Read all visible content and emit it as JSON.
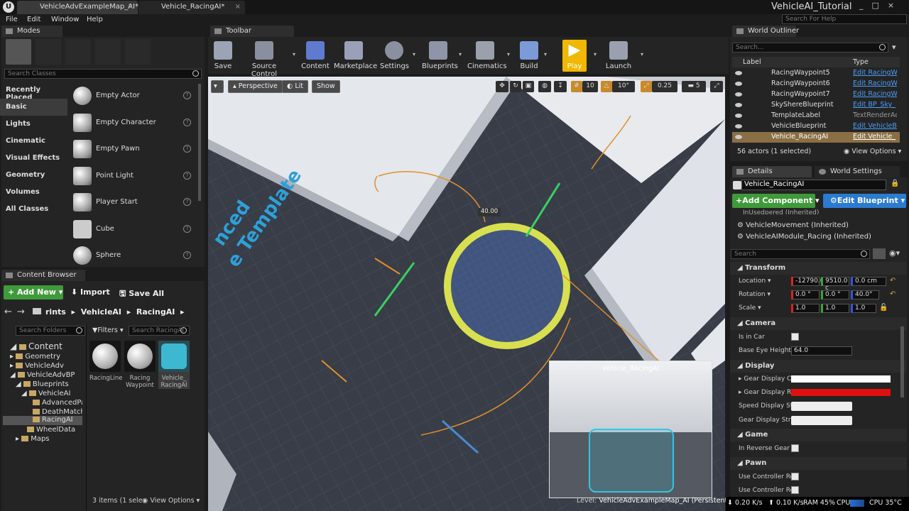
{
  "tabs": [
    "VehicleAdvExampleMap_AI*",
    "Vehicle_RacingAI*"
  ],
  "app_title": "VehicleAI_Tutorial",
  "help_search_placeholder": "Search For Help",
  "menu": [
    "File",
    "Edit",
    "Window",
    "Help"
  ],
  "modes": {
    "title": "Modes",
    "search_placeholder": "Search Classes",
    "categories": [
      "Recently Placed",
      "Basic",
      "Lights",
      "Cinematic",
      "Visual Effects",
      "Geometry",
      "Volumes",
      "All Classes"
    ],
    "classes": [
      "Empty Actor",
      "Empty Character",
      "Empty Pawn",
      "Point Light",
      "Player Start",
      "Cube",
      "Sphere"
    ]
  },
  "toolbar": {
    "title": "Toolbar",
    "buttons": [
      "Save",
      "Source Control",
      "Content",
      "Marketplace",
      "Settings",
      "Blueprints",
      "Cinematics",
      "Build",
      "Play",
      "Launch"
    ]
  },
  "viewport": {
    "perspective": "Perspective",
    "lit": "Lit",
    "show": "Show",
    "grid": "10",
    "angle": "10°",
    "scale": "0.25",
    "speed": "5",
    "measure": "40.00",
    "pip_title": "Vehicle_RacingAI",
    "level_label": "Level:",
    "level_name": "VehicleAdvExampleMap_AI (Persistent)",
    "overlay_text": "nced\ne Template"
  },
  "content_browser": {
    "title": "Content Browser",
    "add_new": "Add New",
    "import": "Import",
    "save_all": "Save All",
    "path": [
      "rints",
      "VehicleAI",
      "RacingAI"
    ],
    "folder_search": "Search Folders",
    "filters": "Filters",
    "asset_search": "Search RacingAI",
    "tree": [
      "Content",
      "Geometry",
      "VehicleAdv",
      "VehicleAdvBP",
      "Blueprints",
      "VehicleAI",
      "AdvancedPa",
      "DeathMatch",
      "RacingAI",
      "WheelData",
      "Maps"
    ],
    "assets": [
      "RacingLine",
      "Racing Waypoint",
      "Vehicle_ RacingAI"
    ],
    "status": "3 items (1 sele",
    "view_options": "View Options"
  },
  "outliner": {
    "title": "World Outliner",
    "search_placeholder": "Search...",
    "col_label": "Label",
    "col_type": "Type",
    "rows": [
      {
        "n": "RacingWaypoint5",
        "t": "Edit RacingW"
      },
      {
        "n": "RacingWaypoint6",
        "t": "Edit RacingW"
      },
      {
        "n": "RacingWaypoint7",
        "t": "Edit RacingW"
      },
      {
        "n": "SkyShereBlueprint",
        "t": "Edit BP_Sky_"
      },
      {
        "n": "TemplateLabel",
        "t": "TextRenderAct"
      },
      {
        "n": "VehicleBlueprint",
        "t": "Edit VehicleB"
      },
      {
        "n": "Vehicle_RacingAI",
        "t": "Edit Vehicle_"
      }
    ],
    "count": "56 actors (1 selected)",
    "view_options": "View Options"
  },
  "details": {
    "tab": "Details",
    "tab2": "World Settings",
    "name": "Vehicle_RacingAI",
    "add_component": "Add Component",
    "edit_bp": "Edit Blueprint",
    "comp_partial": "InUsedpered (Inherited)",
    "components": [
      "VehicleMovement (Inherited)",
      "VehicleAIModule_Racing (Inherited)"
    ],
    "search": "Search",
    "transform": "Transform",
    "location": "Location",
    "rotation": "Rotation",
    "scale": "Scale",
    "loc": [
      "-12790.0",
      "9510.0 c",
      "0.0 cm"
    ],
    "rot": [
      "0.0 °",
      "0.0 °",
      "40.0°"
    ],
    "scl": [
      "1.0",
      "1.0",
      "1.0"
    ],
    "camera": "Camera",
    "is_in_car": "Is in Car",
    "base_eye": "Base Eye Height",
    "base_eye_val": "64.0",
    "display": "Display",
    "gdc": "Gear Display Colo",
    "gdr": "Gear Display Rev",
    "sds": "Speed Display St",
    "gds": "Gear Display Strin",
    "game": "Game",
    "reverse": "In Reverse Gear",
    "pawn": "Pawn",
    "ucr1": "Use Controller Ro",
    "ucr2": "Use Controller Ro"
  },
  "status": {
    "down": "0.20 K/s",
    "up": "0.10 K/s",
    "ram": "RAM 45%",
    "cpu": "CPU",
    "cpu_temp": "CPU 35°C"
  }
}
